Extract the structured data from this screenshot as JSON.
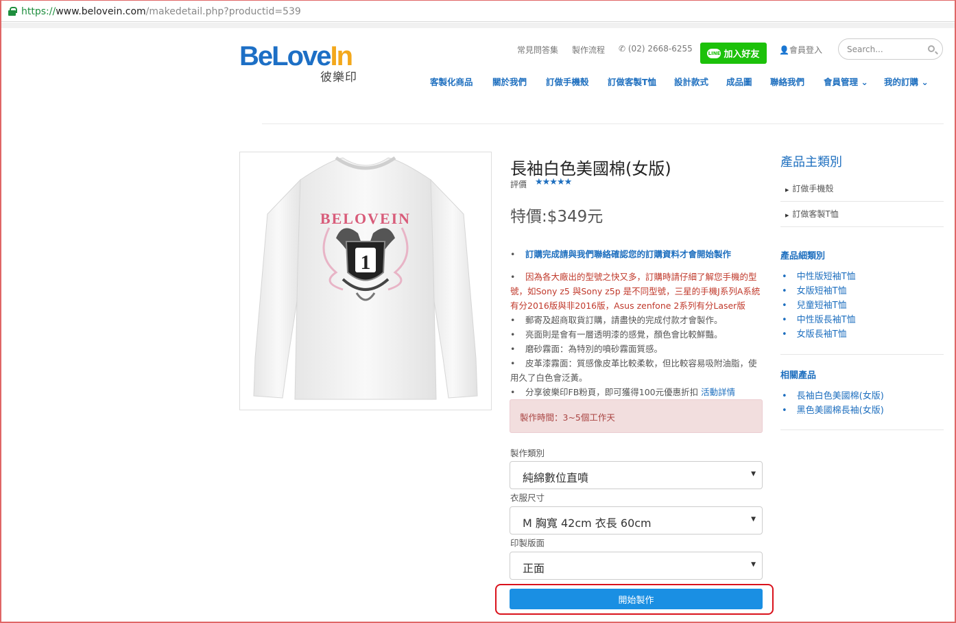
{
  "browser": {
    "url_scheme": "https://",
    "url_host": "www.belovein.com",
    "url_path": "/makedetail.php?productid=539"
  },
  "header": {
    "logo_text_1": "BeLove",
    "logo_text_2": "In",
    "logo_sub": "彼樂印",
    "faq": "常見問答集",
    "process": "製作流程",
    "phone": "(02) 2668-6255",
    "line_badge": "LINE",
    "line_btn": "加入好友",
    "login": "會員登入",
    "search_placeholder": "Search..."
  },
  "nav": [
    {
      "label": "客製化商品"
    },
    {
      "label": "關於我們"
    },
    {
      "label": "訂做手機殼"
    },
    {
      "label": "訂做客製T恤"
    },
    {
      "label": "設計款式"
    },
    {
      "label": "成品圖"
    },
    {
      "label": "聯絡我們"
    },
    {
      "label": "會員管理 ⌄"
    },
    {
      "label": "我的訂購 ⌄"
    }
  ],
  "product": {
    "title": "長袖白色美國棉(女版)",
    "rating_label": "評價",
    "stars": "★★★★★",
    "price": "特價:$349元",
    "shirt_text": "BELOVEIN",
    "shirt_number": "1",
    "bullets": {
      "b1": "訂購完成請與我們聯絡確認您的訂購資料才會開始製作",
      "b2": "因為各大廠出的型號之快又多，訂購時請仔細了解您手機的型號，如Sony z5 與Sony z5p 是不同型號，三星的手機J系列A系統有分2016版與非2016版，Asus zenfone 2系列有分Laser版",
      "b3": "郵寄及超商取貨訂購，請盡快的完成付款才會製作。",
      "b4": "亮面則是會有一層透明漆的感覺，顏色會比較鮮豔。",
      "b5": "磨砂霧面：為特別的噴砂霧面質感。",
      "b6": "皮革漆霧面：質感像皮革比較柔軟，但比較容易吸附油脂，使用久了白色會泛黃。",
      "b7": "分享彼樂印FB粉頁，即可獲得100元優惠折扣",
      "b7_link": "活動詳情"
    },
    "notice": "製作時間：3~5個工作天",
    "field1_label": "製作類別",
    "field1_value": "純綿數位直噴",
    "field2_label": "衣服尺寸",
    "field2_value": "M 胸寬 42cm 衣長 60cm",
    "field3_label": "印製版面",
    "field3_value": "正面",
    "start_btn": "開始製作"
  },
  "sidebar": {
    "main_title": "產品主類別",
    "main_items": [
      "訂做手機殼",
      "訂做客製T恤"
    ],
    "sub_title": "產品細類別",
    "sub_items": [
      "中性版短袖T恤",
      "女版短袖T恤",
      "兒童短袖T恤",
      "中性版長袖T恤",
      "女版長袖T恤"
    ],
    "related_title": "相關產品",
    "related_items": [
      "長袖白色美國棉(女版)",
      "黑色美國棉長袖(女版)"
    ]
  },
  "colors": {
    "brand_blue": "#1e6fbf",
    "line_green": "#1cc10a",
    "button_blue": "#1a8fe3",
    "highlight_red": "#d9111b",
    "notice_bg": "#f2dede"
  }
}
